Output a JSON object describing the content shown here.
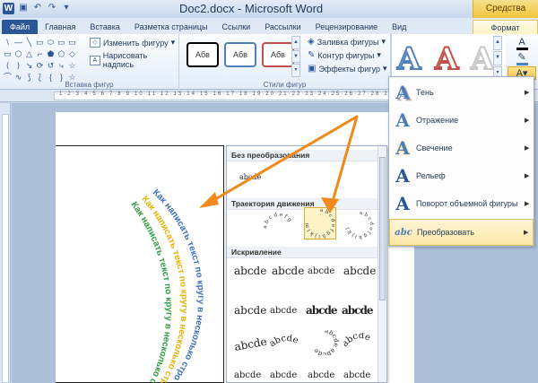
{
  "title_bar": {
    "app_logo": "W",
    "document_title": "Doc2.docx - Microsoft Word",
    "contextual_header": "Средства рисования",
    "qat_icons": [
      "save-icon",
      "undo-icon",
      "redo-icon",
      "customize-icon"
    ]
  },
  "tabs": [
    {
      "label": "Файл"
    },
    {
      "label": "Главная"
    },
    {
      "label": "Вставка"
    },
    {
      "label": "Разметка страницы"
    },
    {
      "label": "Ссылки"
    },
    {
      "label": "Рассылки"
    },
    {
      "label": "Рецензирование"
    },
    {
      "label": "Вид"
    }
  ],
  "active_tab": "Формат",
  "ribbon": {
    "insert_shapes": {
      "group_label": "Вставка фигур",
      "edit_shape": "Изменить фигуру",
      "draw_textbox": "Нарисовать надпись",
      "shape_glyphs": [
        "\\",
        "—",
        "╲",
        "▭",
        "⬭",
        "▭",
        "▭",
        "▭",
        "⬡",
        "△",
        "⌐",
        "⬟",
        "⬠",
        "◇",
        "⟨",
        "⟩",
        "↘",
        "⟳",
        "↺",
        "⤷",
        "☆",
        "⌒",
        "∿",
        "⟆",
        "⟅",
        "{",
        "}",
        "☆"
      ]
    },
    "shape_styles": {
      "group_label": "Стили фигур",
      "style_samples": [
        "Абв",
        "Абв",
        "Абв"
      ],
      "style_borders": [
        "#000000",
        "#4f81bd",
        "#c0504d"
      ],
      "fill_label": "Заливка фигуры",
      "outline_label": "Контур фигуры",
      "effects_label": "Эффекты фигур"
    },
    "wordart": {
      "samples": [
        "A",
        "A",
        "A"
      ],
      "sample_colors": [
        "#4f81bd",
        "#c0504d",
        "#d9d9d9"
      ],
      "tool_icons": [
        "text-fill-icon",
        "text-outline-icon",
        "text-effects-icon"
      ]
    }
  },
  "ruler": {
    "numbers": "·1·2·3·4·5·6·7·8·9·10·11·12·13·14·15·16·17·18·19·20·21·22·23·24·25·26·27·28·29·30·31"
  },
  "transform_panel": {
    "section_no_transform": "Без преобразования",
    "no_transform_sample": "abcde",
    "section_follow_path": "Траектория движения",
    "section_warp": "Искривление",
    "warp_sample": "abcde"
  },
  "text_effects_menu": {
    "items": [
      {
        "label": "Тень",
        "icon": "A"
      },
      {
        "label": "Отражение",
        "icon": "A"
      },
      {
        "label": "Свечение",
        "icon": "A"
      },
      {
        "label": "Рельеф",
        "icon": "A"
      },
      {
        "label": "Поворот объемной фигуры",
        "icon": "A"
      },
      {
        "label": "Преобразовать",
        "icon": "abc"
      }
    ],
    "highlighted_index": 5
  },
  "wordart_curved_text": {
    "line1": "Как написать текст по кругу в несколько строк",
    "line2": "Как написать текст по кругу в несколько строк",
    "line3": "Как написать текст по кругу в несколько строк",
    "colors": [
      "#3d6fbf",
      "#e7b000",
      "#2e9b3f"
    ]
  },
  "accent_colors": {
    "file_tab": "#2b5797",
    "arrow": "#f08a1c",
    "highlight": "#fde7a6"
  }
}
